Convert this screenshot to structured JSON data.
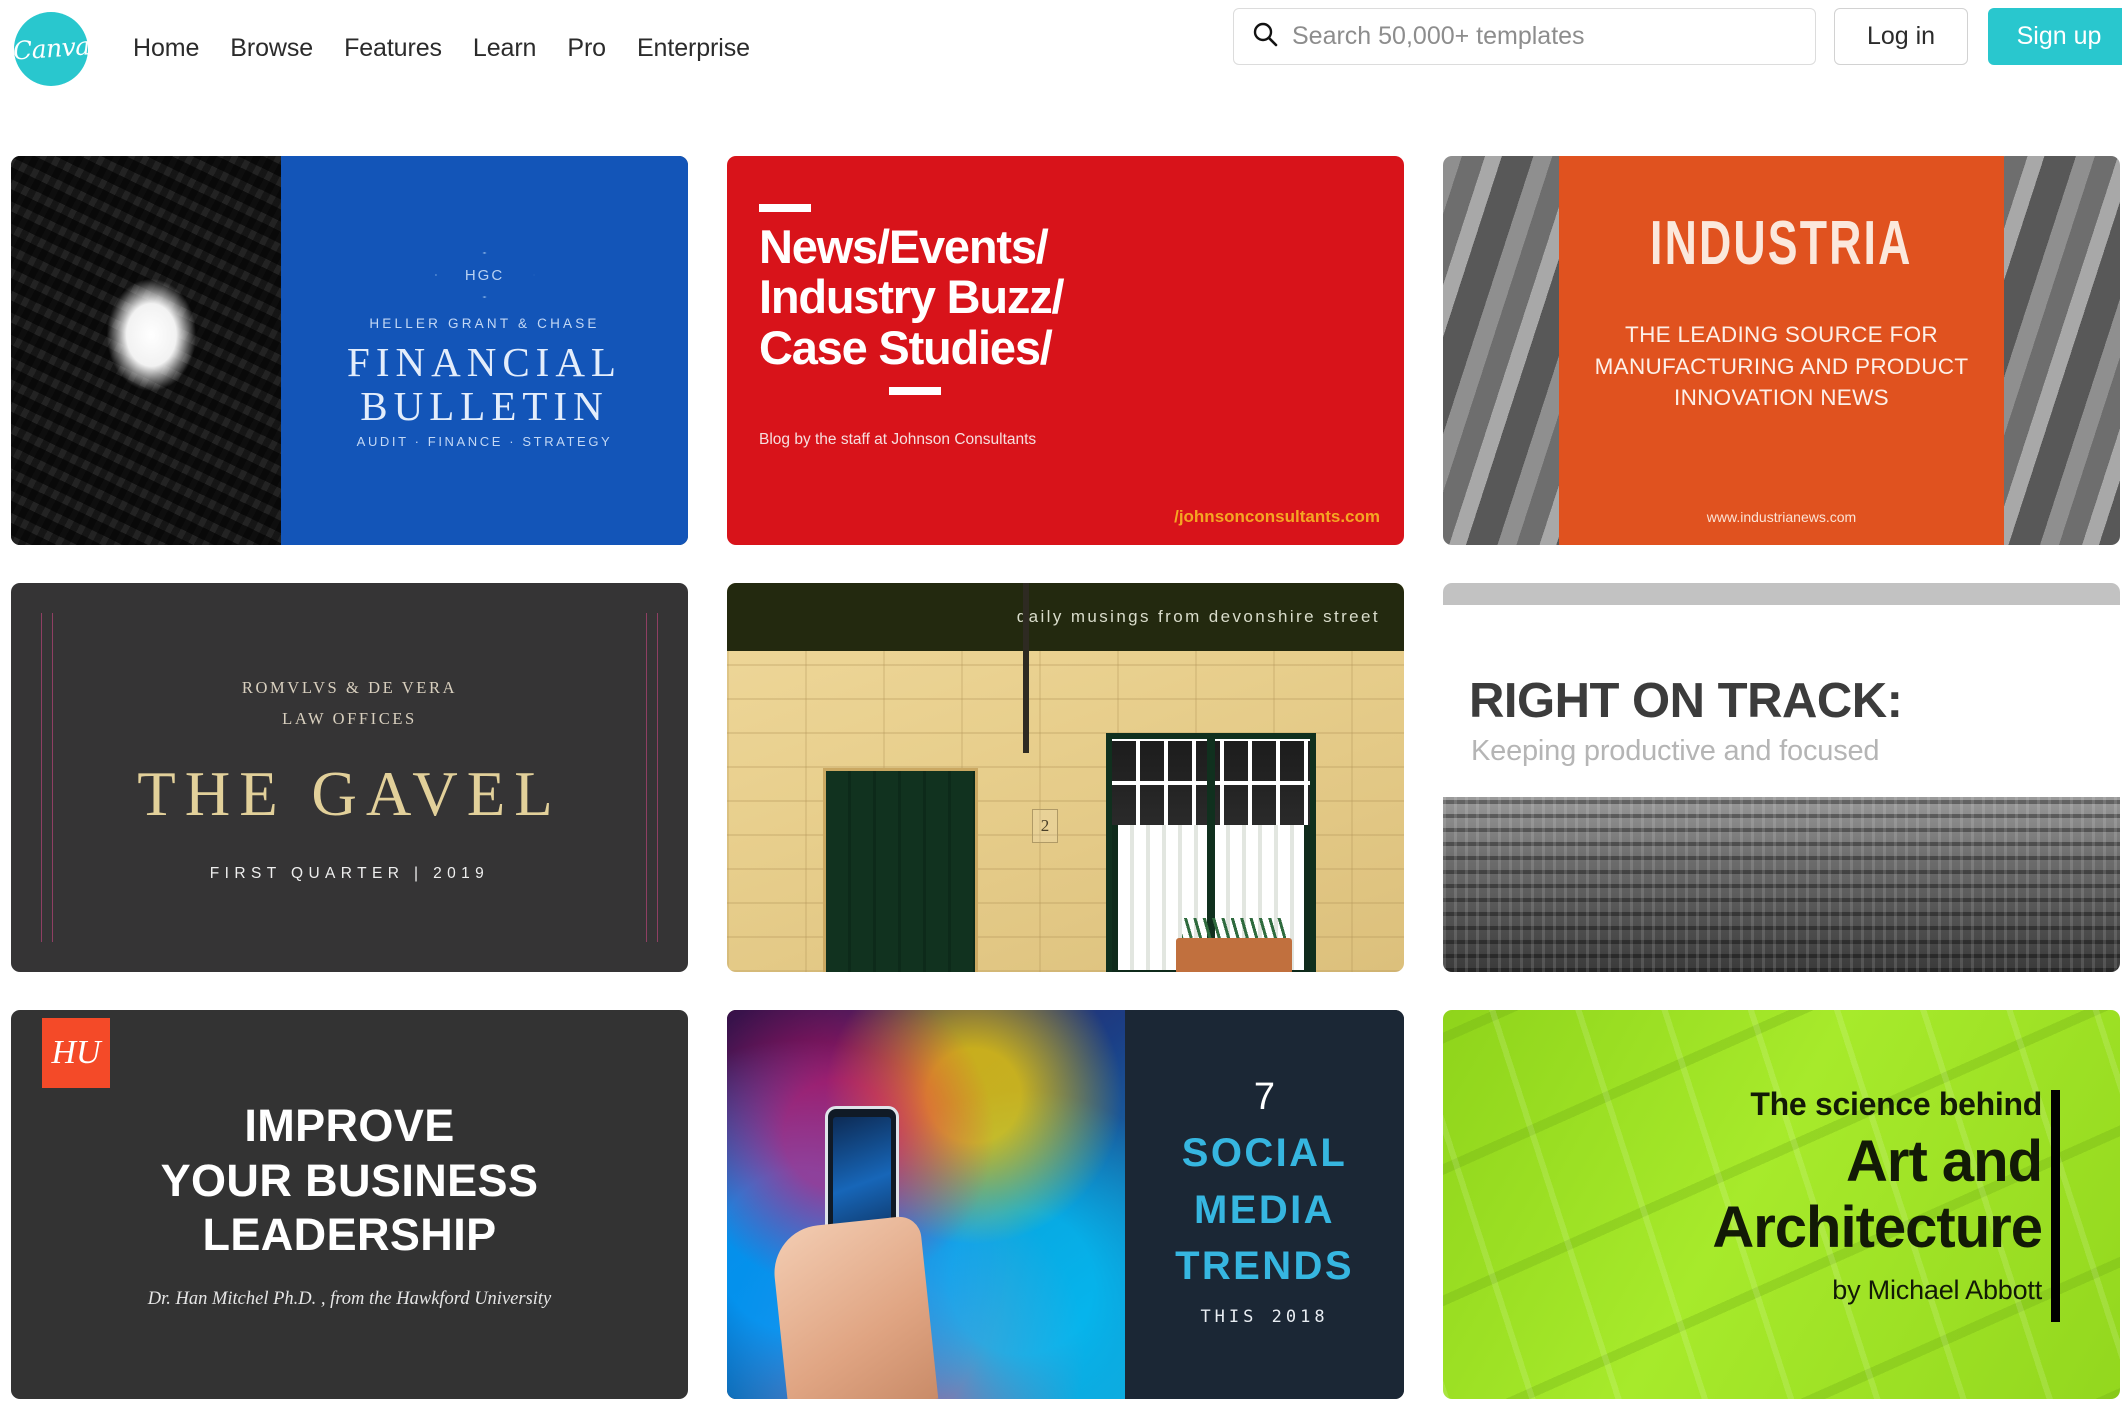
{
  "nav": {
    "logo_text": "Canva",
    "logo_icon": "canva-logo-icon",
    "links": [
      {
        "label": "Home"
      },
      {
        "label": "Browse"
      },
      {
        "label": "Features"
      },
      {
        "label": "Learn"
      },
      {
        "label": "Pro"
      },
      {
        "label": "Enterprise"
      }
    ],
    "search": {
      "icon": "search-icon",
      "value": "",
      "placeholder": "Search 50,000+ templates"
    },
    "login_label": "Log in",
    "signup_label": "Sign up"
  },
  "colors": {
    "brand_teal": "#29c7ce",
    "card1_blue": "#1355b8",
    "card2_red": "#d8131a",
    "card2_url_orange": "#f5a623",
    "card3_orange": "#e0521f",
    "card4_dark": "#353435",
    "card4_gold": "#e2d09a",
    "card4_pink_rule": "#8f3f63",
    "card5_band": "#23290f",
    "card6_topbar": "#c2c2c2",
    "card7_badge_red": "#f44a28",
    "card8_dark": "#1b2735",
    "card8_cyan": "#36b6e0",
    "card9_green": "#a7ea2b"
  },
  "templates": [
    {
      "name": "financial-bulletin",
      "monogram": "HGC",
      "firm": "HELLER GRANT & CHASE",
      "title_line1": "FINANCIAL",
      "title_line2": "BULLETIN",
      "tagline": "AUDIT · FINANCE · STRATEGY"
    },
    {
      "name": "news-events-industry-buzz",
      "heading_line1": "News/Events/",
      "heading_line2": "Industry Buzz/",
      "heading_line3": "Case Studies/",
      "subtitle": "Blog by the staff at Johnson Consultants",
      "url": "/johnsonconsultants.com"
    },
    {
      "name": "industria",
      "title": "INDUSTRIA",
      "body_line1": "THE LEADING SOURCE FOR",
      "body_line2": "MANUFACTURING AND PRODUCT",
      "body_line3": "INNOVATION NEWS",
      "url": "www.industrianews.com"
    },
    {
      "name": "the-gavel",
      "firm_line1": "ROMVLVS & DE VERA",
      "firm_line2": "LAW OFFICES",
      "title": "THE GAVEL",
      "issue": "FIRST QUARTER | 2019"
    },
    {
      "name": "devonshire-street",
      "band_text": "daily musings from devonshire street",
      "house_number": "2"
    },
    {
      "name": "right-on-track",
      "title": "RIGHT ON TRACK:",
      "subtitle": "Keeping productive and focused"
    },
    {
      "name": "improve-your-business-leadership",
      "badge": "HU",
      "heading_line1": "IMPROVE",
      "heading_line2": "YOUR BUSINESS",
      "heading_line3": "LEADERSHIP",
      "byline": "Dr. Han Mitchel Ph.D. , from the Hawkford University"
    },
    {
      "name": "social-media-trends",
      "number": "7",
      "word1": "SOCIAL",
      "word2": "MEDIA",
      "word3": "TRENDS",
      "year": "THIS 2018"
    },
    {
      "name": "art-and-architecture",
      "line1": "The science behind",
      "line2": "Art and",
      "line3": "Architecture",
      "byline": "by Michael Abbott"
    }
  ]
}
